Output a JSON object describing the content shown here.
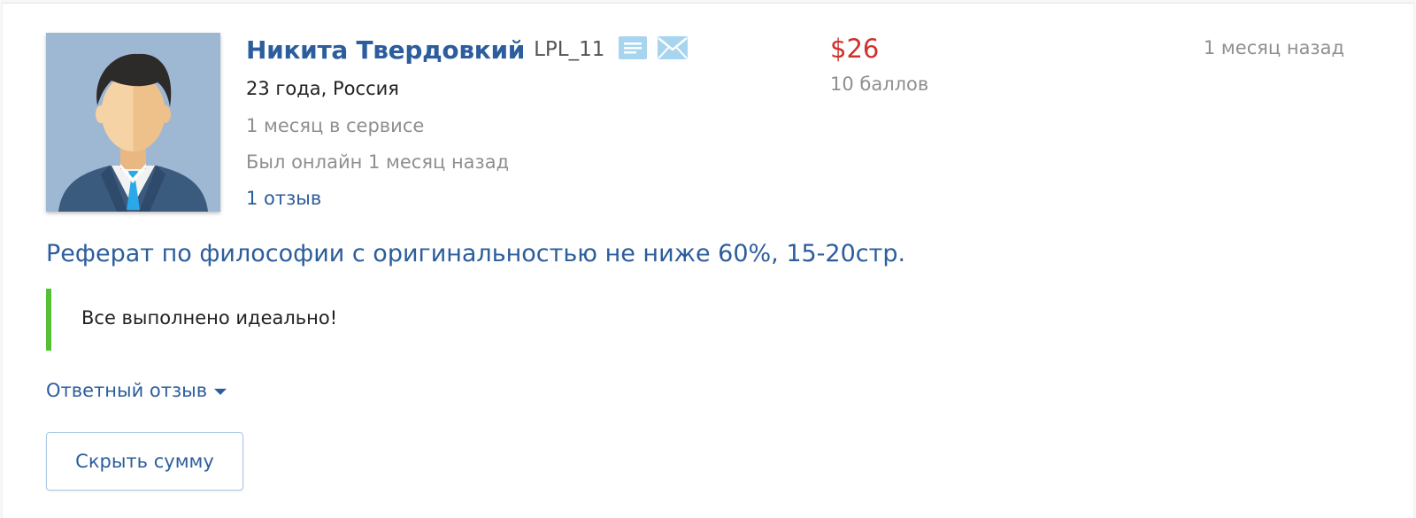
{
  "user": {
    "name": "Никита Твердовкий",
    "login": "LPL_11",
    "age_country": "23 года, Россия",
    "service_time": "1 месяц в сервисе",
    "last_online": "Был онлайн 1 месяц назад",
    "reviews_link": "1 отзыв",
    "icons": [
      "message-icon",
      "mail-icon"
    ]
  },
  "offer": {
    "price": "$26",
    "points": "10 баллов"
  },
  "review": {
    "date": "1 месяц назад",
    "task_title": "Реферат по философии с оригинальностью не ниже 60%, 15-20стр.",
    "text": "Все выполнено идеально!",
    "reply_toggle": "Ответный отзыв",
    "hide_amount_button": "Скрыть сумму"
  },
  "colors": {
    "link_blue": "#2c5d9c",
    "price_red": "#d0312d",
    "quote_green": "#55bf35",
    "muted_gray": "#8f8f8f",
    "icon_blue": "#a7d4ee"
  }
}
